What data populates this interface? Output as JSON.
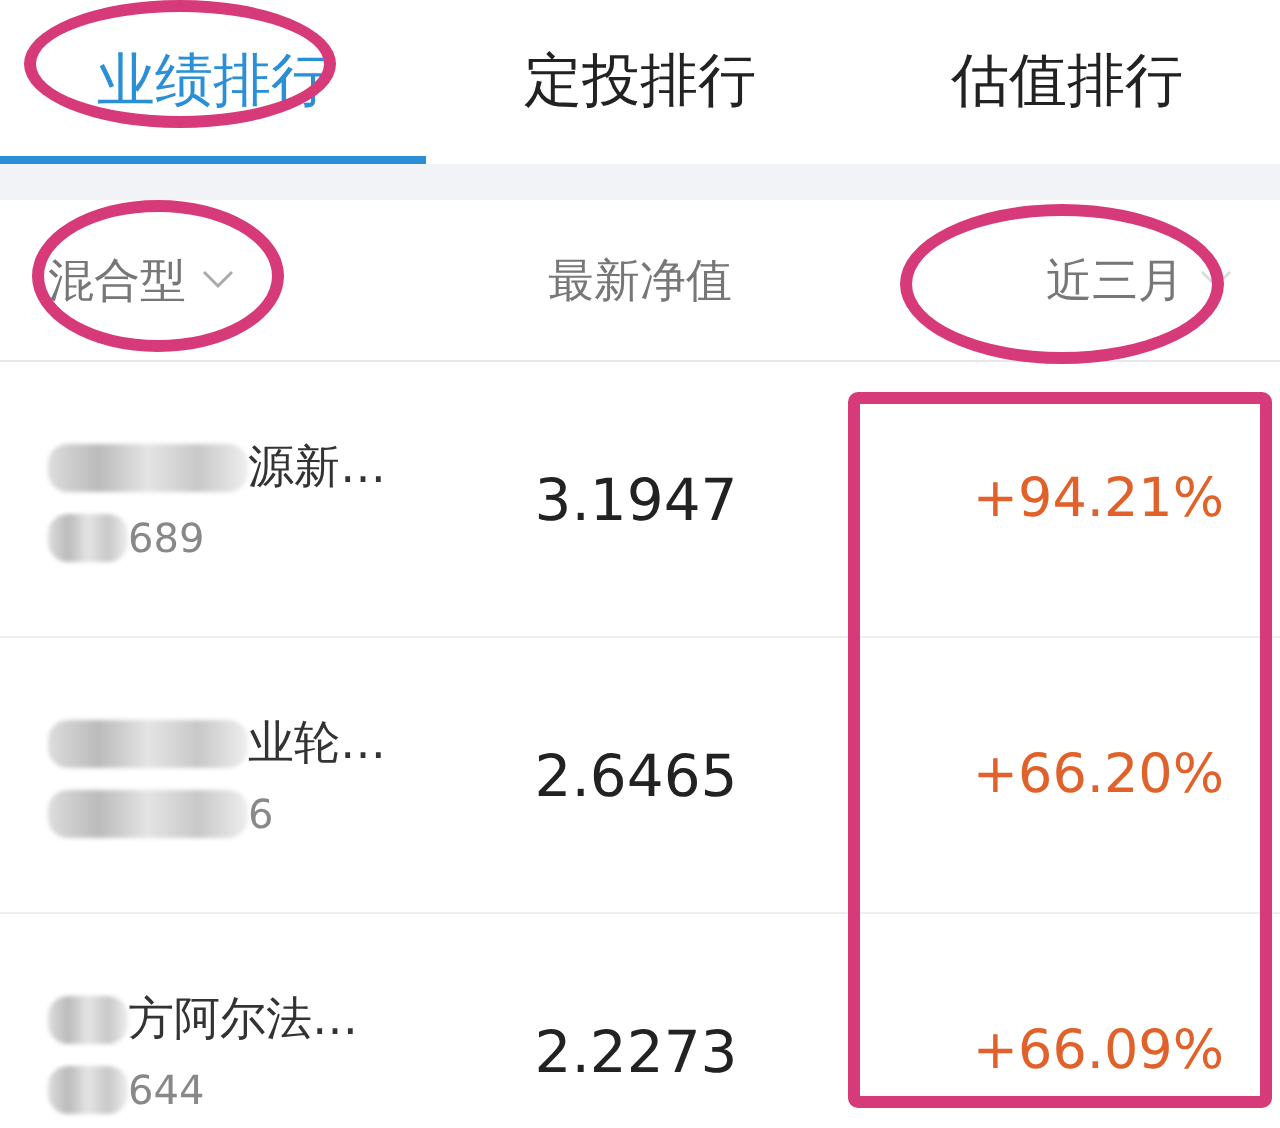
{
  "tabs": [
    {
      "label": "业绩排行",
      "selected": true
    },
    {
      "label": "定投排行",
      "selected": false
    },
    {
      "label": "估值排行",
      "selected": false
    }
  ],
  "header": {
    "category": "混合型",
    "nav": "最新净值",
    "period": "近三月"
  },
  "rows": [
    {
      "name": "源新…",
      "code": "689",
      "nav": "3.1947",
      "change": "+94.21%"
    },
    {
      "name": "业轮…",
      "code": "6",
      "nav": "2.6465",
      "change": "+66.20%"
    },
    {
      "name": "方阿尔法…",
      "code": "644",
      "nav": "2.2273",
      "change": "+66.09%"
    }
  ]
}
